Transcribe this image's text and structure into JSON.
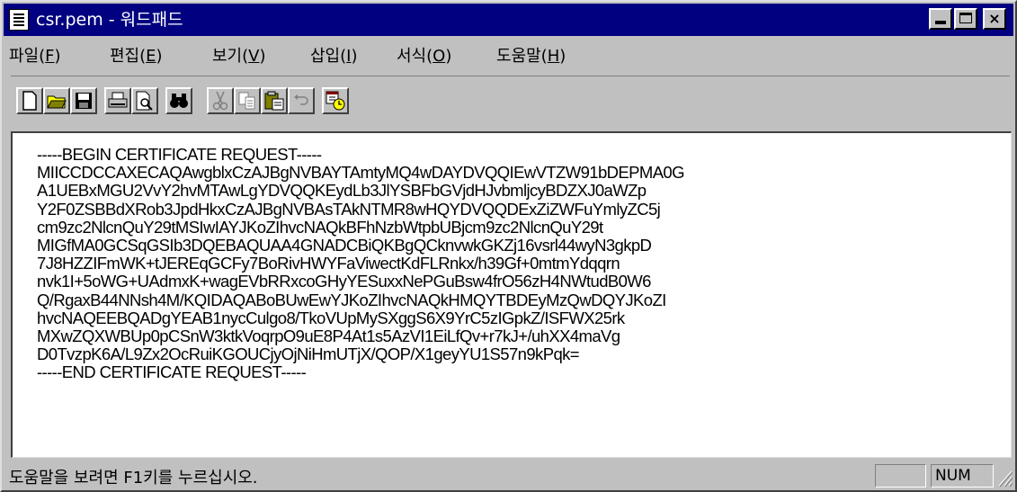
{
  "window": {
    "title": "csr.pem - 워드패드",
    "controls": {
      "minimize": "",
      "maximize": "",
      "close": "×"
    }
  },
  "menu": [
    {
      "label": "파일(",
      "key": "F",
      "close": ")"
    },
    {
      "label": "편집(",
      "key": "E",
      "close": ")"
    },
    {
      "label": "보기(",
      "key": "V",
      "close": ")"
    },
    {
      "label": "삽입(",
      "key": "I",
      "close": ")"
    },
    {
      "label": "서식(",
      "key": "O",
      "close": ")"
    },
    {
      "label": "도움말(",
      "key": "H",
      "close": ")"
    }
  ],
  "toolbar": {
    "icons": [
      "new-document-icon",
      "open-folder-icon",
      "save-disk-icon",
      "print-icon",
      "print-preview-icon",
      "find-binoculars-icon",
      "cut-scissors-icon",
      "copy-icon",
      "paste-clipboard-icon",
      "undo-icon",
      "insert-datetime-icon"
    ]
  },
  "document": {
    "lines": [
      "-----BEGIN CERTIFICATE REQUEST-----",
      "MIICCDCCAXECAQAwgblxCzAJBgNVBAYTAmtyMQ4wDAYDVQQIEwVTZW91bDEPMA0G",
      "A1UEBxMGU2VvY2hvMTAwLgYDVQQKEydLb3JlYSBFbGVjdHJvbmljcyBDZXJ0aWZp",
      "Y2F0ZSBBdXRob3JpdHkxCzAJBgNVBAsTAkNTMR8wHQYDVQQDExZiZWFuYmlyZC5j",
      "cm9zc2NlcnQuY29tMSIwIAYJKoZIhvcNAQkBFhNzbWtpbUBjcm9zc2NlcnQuY29t",
      "MIGfMA0GCSqGSIb3DQEBAQUAA4GNADCBiQKBgQCknvwkGKZj16vsrl44wyN3gkpD",
      "7J8HZZIFmWK+tJEREqGCFy7BoRivHWYFaViwectKdFLRnkx/h39Gf+0mtmYdqqrn",
      "nvk1I+5oWG+UAdmxK+wagEVbRRxcoGHyYESuxxNePGuBsw4frO56zH4NWtudB0W6",
      "Q/RgaxB44NNsh4M/KQIDAQABoBUwEwYJKoZIhvcNAQkHMQYTBDEyMzQwDQYJKoZI",
      "hvcNAQEEBQADgYEAB1nycCulgo8/TkoVUpMySXggS6X9YrC5zIGpkZ/ISFWX25rk",
      "MXwZQXWBUp0pCSnW3ktkVoqrpO9uE8P4At1s5AzVI1EiLfQv+r7kJ+/uhXX4maVg",
      "D0TvzpK6A/L9Zx2OcRuiKGOUCjyOjNiHmUTjX/QOP/X1geyYU1S57n9kPqk=",
      "-----END CERTIFICATE REQUEST-----"
    ]
  },
  "status": {
    "message": "도움말을 보려면 F1키를 누르십시오.",
    "panel_blank": "",
    "num": "NUM"
  }
}
